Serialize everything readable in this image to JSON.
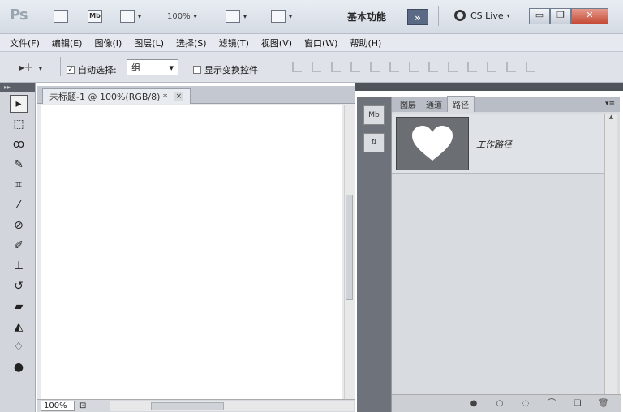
{
  "app": {
    "logo": "Ps",
    "zoom_label": "100%",
    "workspace": "基本功能",
    "overflow_label": "»",
    "cslive_label": "CS Live"
  },
  "menu": [
    {
      "label": "文件(F)"
    },
    {
      "label": "编辑(E)"
    },
    {
      "label": "图像(I)"
    },
    {
      "label": "图层(L)"
    },
    {
      "label": "选择(S)"
    },
    {
      "label": "滤镜(T)"
    },
    {
      "label": "视图(V)"
    },
    {
      "label": "窗口(W)"
    },
    {
      "label": "帮助(H)"
    }
  ],
  "options": {
    "auto_select_label": "自动选择:",
    "auto_select_value": "组",
    "show_transform_label": "显示变换控件"
  },
  "document": {
    "tab_title": "未标题-1 @ 100%(RGB/8) *",
    "status_zoom": "100%"
  },
  "panel": {
    "tabs": [
      {
        "label": "图层"
      },
      {
        "label": "通道"
      },
      {
        "label": "路径"
      }
    ],
    "paths": [
      {
        "name": "工作路径"
      }
    ]
  }
}
